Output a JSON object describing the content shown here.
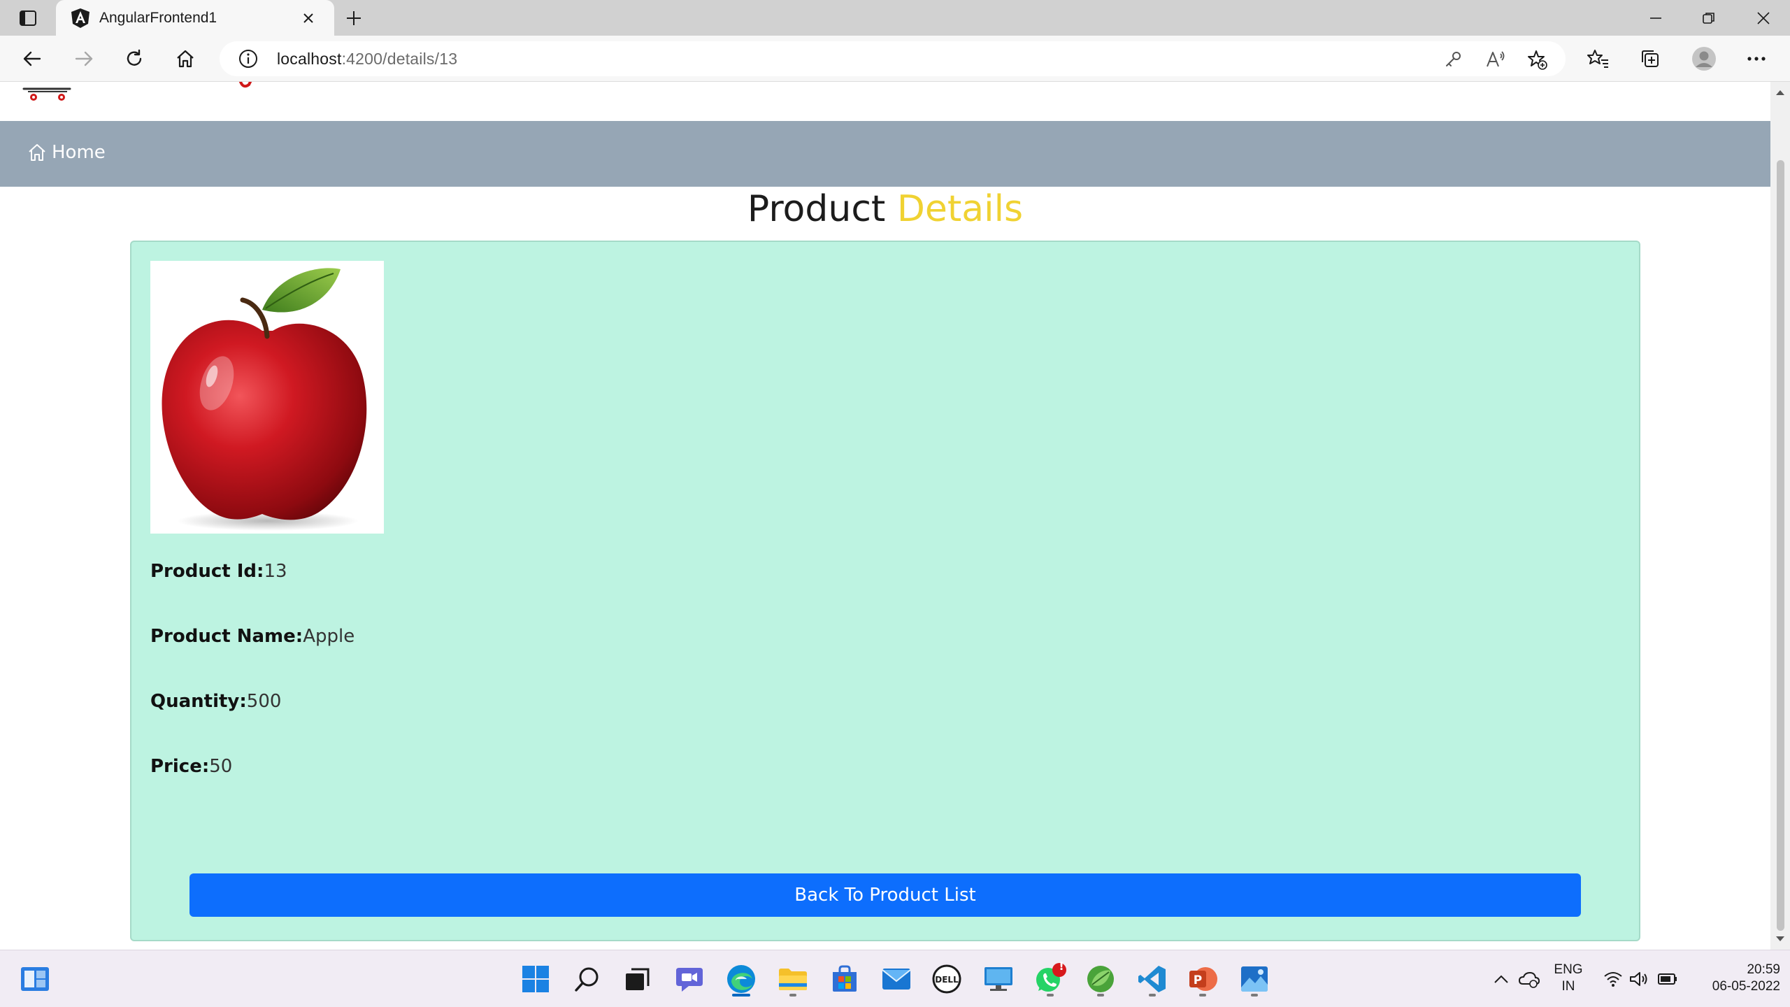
{
  "browser": {
    "tab_title": "AngularFrontend1",
    "address_host": "localhost",
    "address_path": ":4200/details/13"
  },
  "page": {
    "nav": {
      "home_label": "Home"
    },
    "heading": {
      "part1": "Product",
      "part2": "Details"
    },
    "product": {
      "image_alt": "Apple",
      "fields": [
        {
          "label": "Product Id:",
          "value": "13"
        },
        {
          "label": "Product Name:",
          "value": "Apple"
        },
        {
          "label": "Quantity:",
          "value": "500"
        },
        {
          "label": "Price:",
          "value": "50"
        }
      ]
    },
    "back_button_label": "Back To Product List"
  },
  "taskbar": {
    "apps": [
      "start",
      "search",
      "task-view",
      "chat",
      "edge",
      "file-explorer",
      "store",
      "mail",
      "dell",
      "remote-desktop",
      "whatsapp",
      "spring-tool",
      "vscode",
      "powerpoint",
      "photos"
    ],
    "whatsapp_badge": "!",
    "lang_line1": "ENG",
    "lang_line2": "IN",
    "time": "20:59",
    "date": "06-05-2022"
  },
  "colors": {
    "page_nav_bg": "#96a6b5",
    "heading_accent": "#f0d232",
    "card_bg": "#bdf3e1",
    "button_bg": "#0d6efd"
  }
}
